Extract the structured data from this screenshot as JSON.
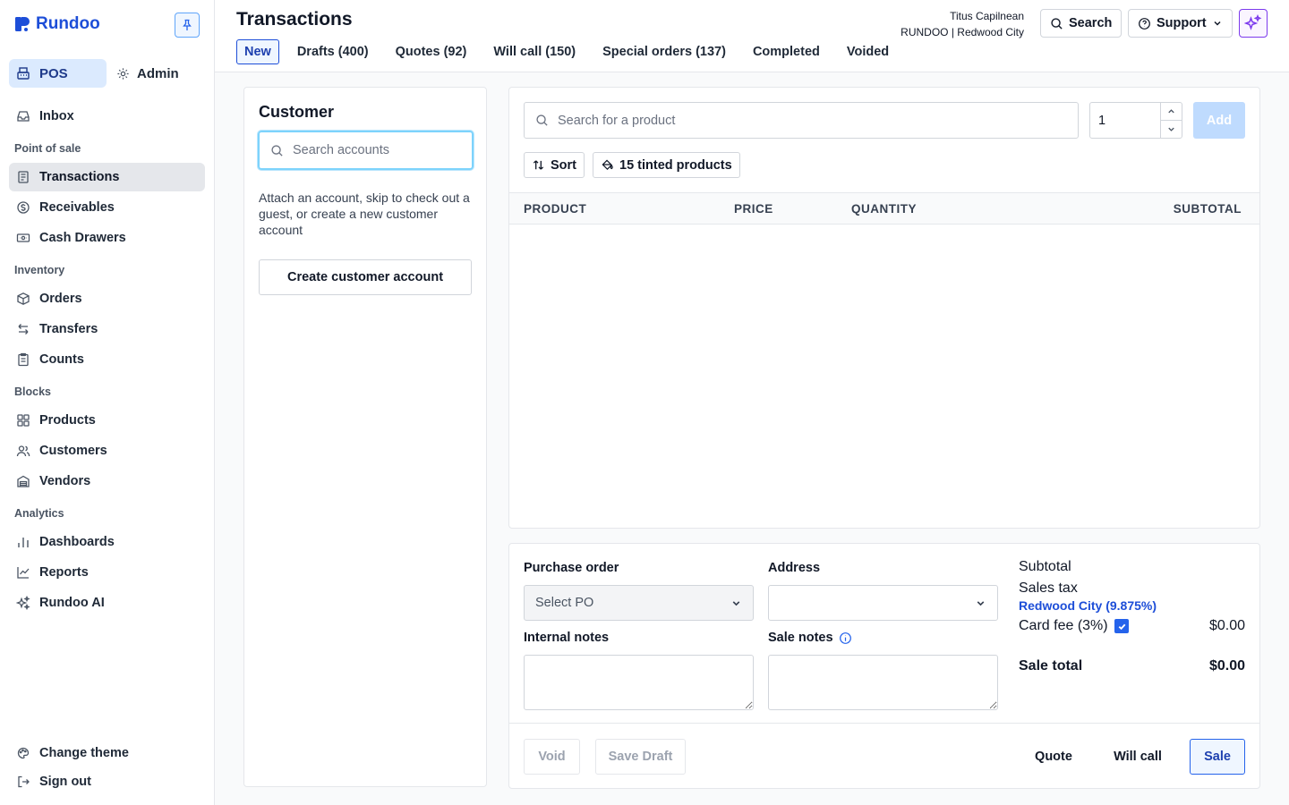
{
  "app": {
    "name": "Rundoo"
  },
  "sidebar": {
    "mode_pos": "POS",
    "mode_admin": "Admin",
    "inbox": "Inbox",
    "sections": {
      "point_of_sale": "Point of sale",
      "inventory": "Inventory",
      "blocks": "Blocks",
      "analytics": "Analytics"
    },
    "items": {
      "transactions": "Transactions",
      "receivables": "Receivables",
      "cash_drawers": "Cash Drawers",
      "orders": "Orders",
      "transfers": "Transfers",
      "counts": "Counts",
      "products": "Products",
      "customers": "Customers",
      "vendors": "Vendors",
      "dashboards": "Dashboards",
      "reports": "Reports",
      "rundoo_ai": "Rundoo AI"
    },
    "change_theme": "Change theme",
    "sign_out": "Sign out"
  },
  "header": {
    "title": "Transactions",
    "user_name": "Titus Capilnean",
    "store": "RUNDOO | Redwood City",
    "search_label": "Search",
    "support_label": "Support",
    "tabs": [
      "New",
      "Drafts (400)",
      "Quotes (92)",
      "Will call (150)",
      "Special orders (137)",
      "Completed",
      "Voided"
    ],
    "active_tab": "New"
  },
  "customer": {
    "title": "Customer",
    "search_placeholder": "Search accounts",
    "help_text": "Attach an account, skip to check out a guest, or create a new customer account",
    "create_button": "Create customer account"
  },
  "products": {
    "search_placeholder": "Search for a product",
    "quantity": "1",
    "add_label": "Add",
    "sort_label": "Sort",
    "tinted_label": "15 tinted products",
    "columns": {
      "product": "PRODUCT",
      "price": "PRICE",
      "quantity": "QUANTITY",
      "subtotal": "SUBTOTAL"
    },
    "rows": []
  },
  "checkout": {
    "purchase_order_label": "Purchase order",
    "purchase_order_placeholder": "Select PO",
    "address_label": "Address",
    "address_value": "",
    "internal_notes_label": "Internal notes",
    "sale_notes_label": "Sale notes",
    "subtotal_label": "Subtotal",
    "sales_tax_label": "Sales tax",
    "tax_jurisdiction": "Redwood City (9.875%)",
    "card_fee_label": "Card fee (3%)",
    "card_fee_checked": true,
    "card_fee_amount": "$0.00",
    "sale_total_label": "Sale total",
    "sale_total": "$0.00",
    "actions": {
      "void": "Void",
      "save_draft": "Save Draft",
      "quote": "Quote",
      "will_call": "Will call",
      "sale": "Sale"
    }
  },
  "colors": {
    "brand": "#1d4ed8",
    "active_tab_bg": "#eff6ff",
    "ai_accent": "#7c3aed",
    "focus_ring": "#7dd3fc"
  }
}
